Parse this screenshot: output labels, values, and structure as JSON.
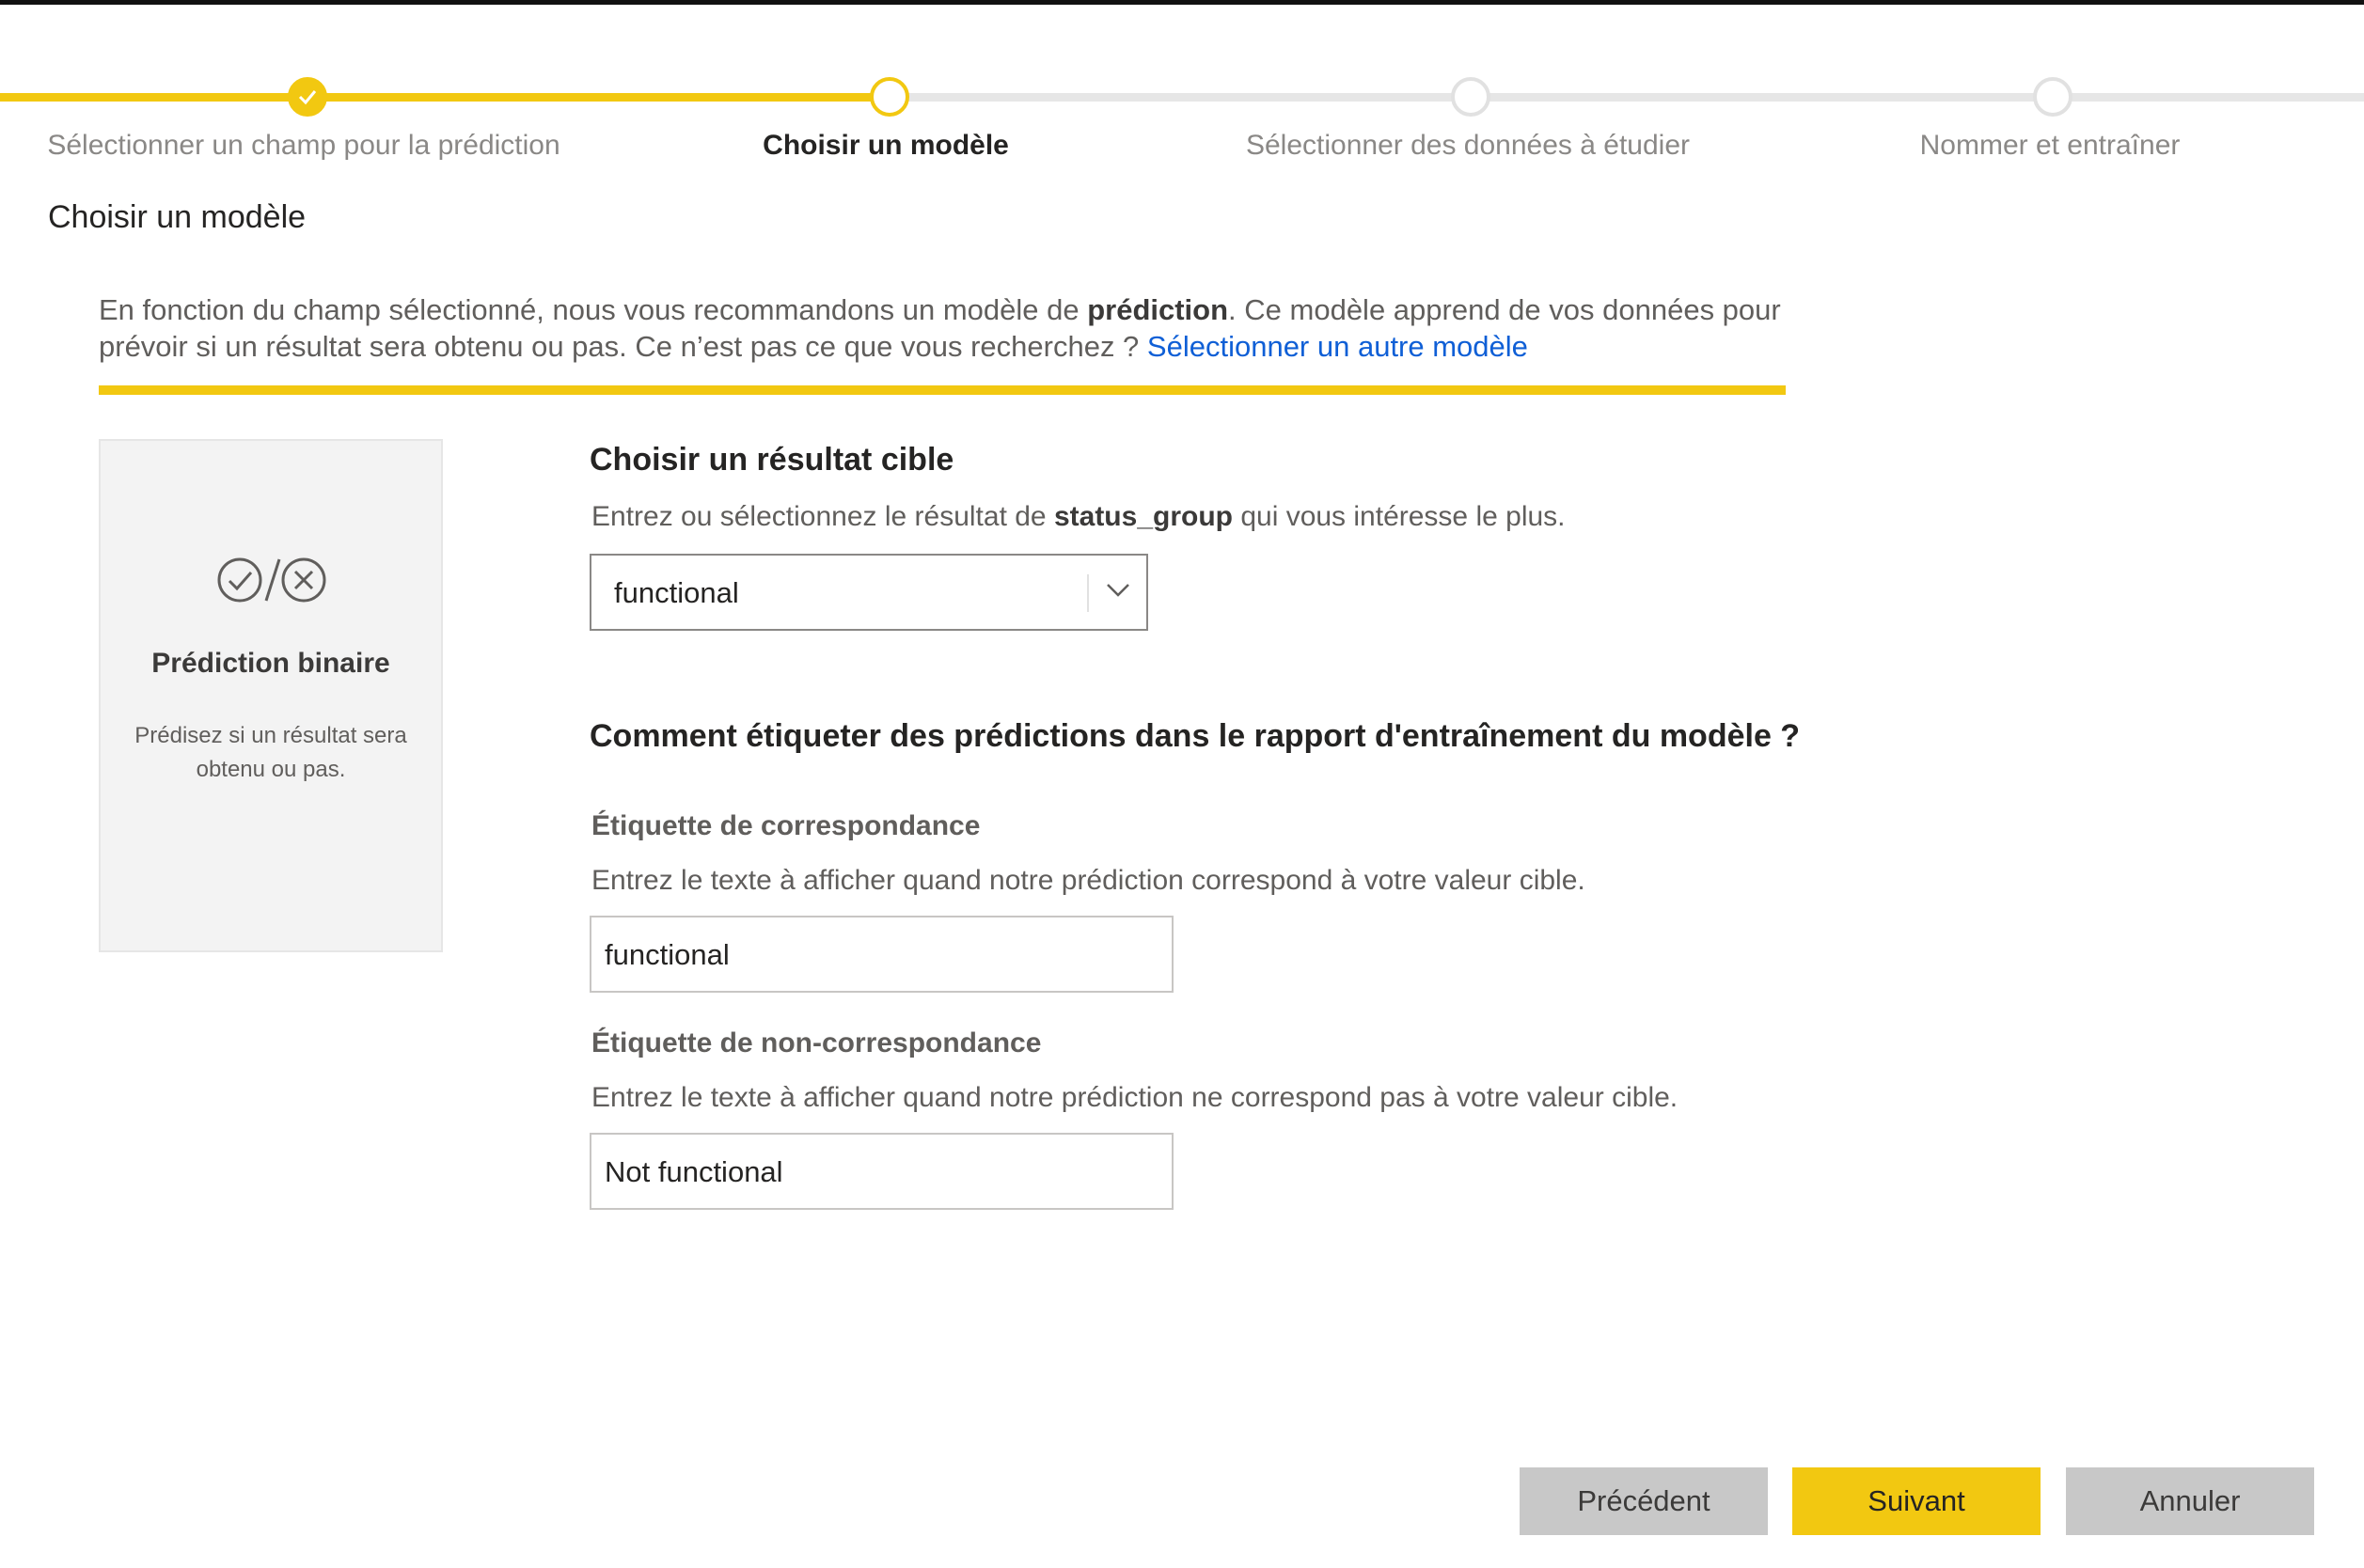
{
  "stepper": {
    "steps": [
      {
        "label": "Sélectionner un champ pour la prédiction",
        "state": "completed"
      },
      {
        "label": "Choisir un modèle",
        "state": "current"
      },
      {
        "label": "Sélectionner des données à étudier",
        "state": "todo"
      },
      {
        "label": "Nommer et entraîner",
        "state": "todo"
      }
    ]
  },
  "page": {
    "title": "Choisir un modèle"
  },
  "intro": {
    "text_before": "En fonction du champ sélectionné, nous vous recommandons un modèle de ",
    "bold": "prédiction",
    "text_after": ". Ce modèle apprend de vos données pour prévoir si un résultat sera obtenu ou pas. Ce n’est pas ce que vous recherchez ? ",
    "link": "Sélectionner un autre modèle"
  },
  "model_card": {
    "title": "Prédiction binaire",
    "description": "Prédisez si un résultat sera obtenu ou pas.",
    "icon": "check-slash-cross-icon"
  },
  "target": {
    "title": "Choisir un résultat cible",
    "hint_before": "Entrez ou sélectionnez le résultat de ",
    "hint_bold": "status_group",
    "hint_after": " qui vous intéresse le plus.",
    "selected": "functional"
  },
  "labels": {
    "title": "Comment étiqueter des prédictions dans le rapport d'entraînement du modèle ?",
    "match": {
      "label": "Étiquette de correspondance",
      "hint": "Entrez le texte à afficher quand notre prédiction correspond à votre valeur cible.",
      "value": "functional"
    },
    "nomatch": {
      "label": "Étiquette de non-correspondance",
      "hint": "Entrez le texte à afficher quand notre prédiction ne correspond pas à votre valeur cible.",
      "value": "Not functional"
    }
  },
  "footer": {
    "previous": "Précédent",
    "next": "Suivant",
    "cancel": "Annuler"
  },
  "colors": {
    "accent": "#f2c811",
    "link": "#0f5fd6",
    "button_secondary": "#c8c8c8"
  }
}
